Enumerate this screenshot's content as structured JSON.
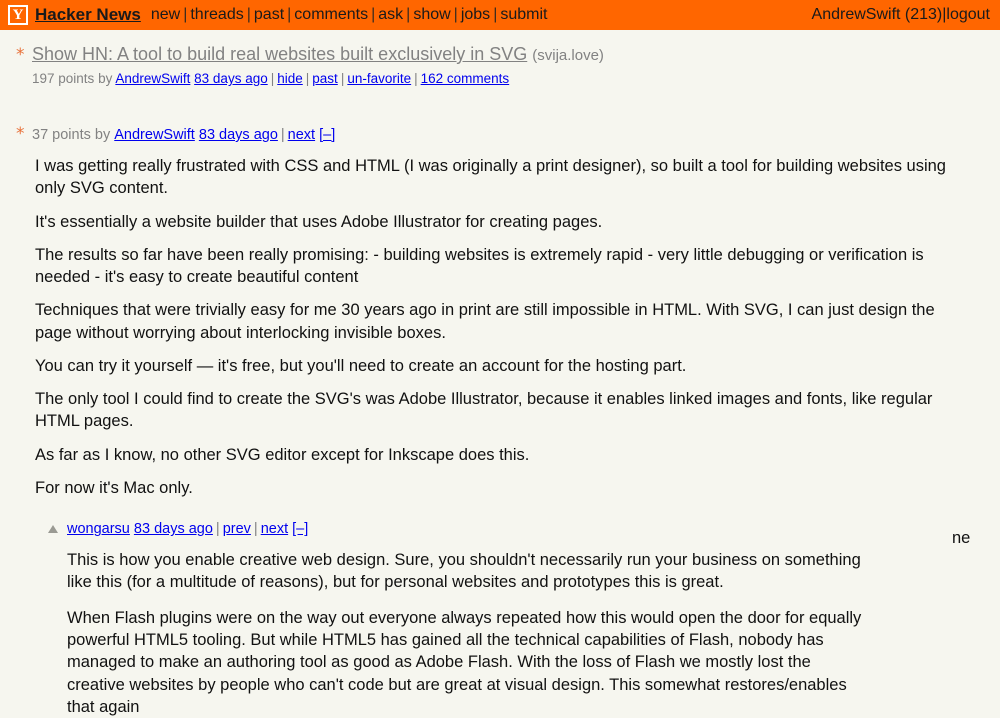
{
  "colors": {
    "header_bg": "#ff6600",
    "page_bg": "#f6f6ef",
    "meta_text": "#828282",
    "body_text": "#111111",
    "star": "#e8713a"
  },
  "header": {
    "logo_letter": "Y",
    "site_title": "Hacker News",
    "nav": [
      {
        "label": "new"
      },
      {
        "label": "threads"
      },
      {
        "label": "past"
      },
      {
        "label": "comments"
      },
      {
        "label": "ask"
      },
      {
        "label": "show"
      },
      {
        "label": "jobs"
      },
      {
        "label": "submit"
      }
    ],
    "nav_separator": "|",
    "user": "AndrewSwift (213)",
    "logout_label": "logout"
  },
  "story": {
    "star_glyph": "*",
    "title": "Show HN: A tool to build real websites built exclusively in SVG",
    "domain": "(svija.love)",
    "subtext": {
      "points": "197 points",
      "by": "by",
      "author": "AndrewSwift",
      "age": "83 days ago",
      "sep": "|",
      "hide": "hide",
      "past": "past",
      "unfavorite": "un-favorite",
      "comments": "162 comments"
    }
  },
  "top_comment": {
    "star_glyph": "*",
    "points": "37 points",
    "by": "by",
    "author": "AndrewSwift",
    "age": "83 days ago",
    "sep": "|",
    "next_label": "next",
    "collapse_label": "[–]",
    "paragraphs": [
      "I was getting really frustrated with CSS and HTML (I was originally a print designer), so built a tool for building websites using only SVG content.",
      "It's essentially a website builder that uses Adobe Illustrator for creating pages.",
      "The results so far have been really promising: - building websites is extremely rapid - very little debugging or verification is needed - it's easy to create beautiful content",
      "Techniques that were trivially easy for me 30 years ago in print are still impossible in HTML. With SVG, I can just design the page without worrying about interlocking invisible boxes.",
      "You can try it yourself — it's free, but you'll need to create an account for the hosting part.",
      "The only tool I could find to create the SVG's was Adobe Illustrator, because it enables linked images and fonts, like regular HTML pages.",
      "As far as I know, no other SVG editor except for Inkscape does this.",
      "For now it's Mac only."
    ]
  },
  "nested_reply": {
    "upvote_icon": "upvote-triangle",
    "author": "wongarsu",
    "age": "83 days ago",
    "sep": "|",
    "prev_label": "prev",
    "next_label": "next",
    "collapse_label": "[–]",
    "paragraphs": [
      "This is how you enable creative web design. Sure, you shouldn't necessarily run your business on something like this (for a multitude of reasons), but for personal websites and prototypes this is great.",
      "When Flash plugins were on the way out everyone always repeated how this would open the door for equally powerful HTML5 tooling. But while HTML5 has gained all the technical capabilities of Flash, nobody has managed to make an authoring tool as good as Adobe Flash. With the loss of Flash we mostly lost the creative websites by people who can't code but are great at visual design. This somewhat restores/enables that again"
    ]
  },
  "overflow_fragment": {
    "text": "ne"
  }
}
